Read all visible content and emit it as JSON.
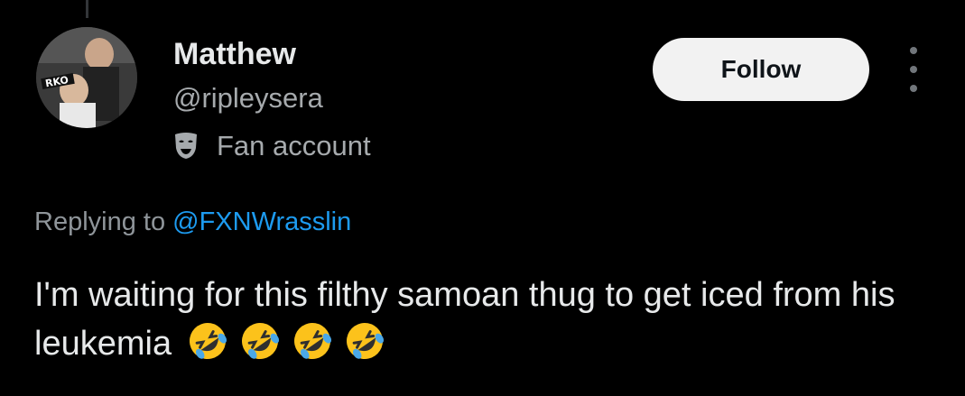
{
  "user": {
    "display_name": "Matthew",
    "handle": "@ripleysera",
    "fan_label": "Fan account",
    "avatar_text": "RKO"
  },
  "actions": {
    "follow_label": "Follow"
  },
  "reply": {
    "prefix": "Replying to ",
    "target": "@FXNWrasslin"
  },
  "tweet": {
    "text": "I'm waiting for this filthy samoan thug to get iced from his leukemia",
    "emojis": [
      "rolling-on-floor-laughing-emoji",
      "rolling-on-floor-laughing-emoji",
      "rolling-on-floor-laughing-emoji",
      "rolling-on-floor-laughing-emoji"
    ]
  },
  "colors": {
    "background": "#000000",
    "primary_text": "#e7e9ea",
    "secondary_text": "#a6aaad",
    "link": "#1d9bf0",
    "follow_bg": "#f2f2f2"
  }
}
